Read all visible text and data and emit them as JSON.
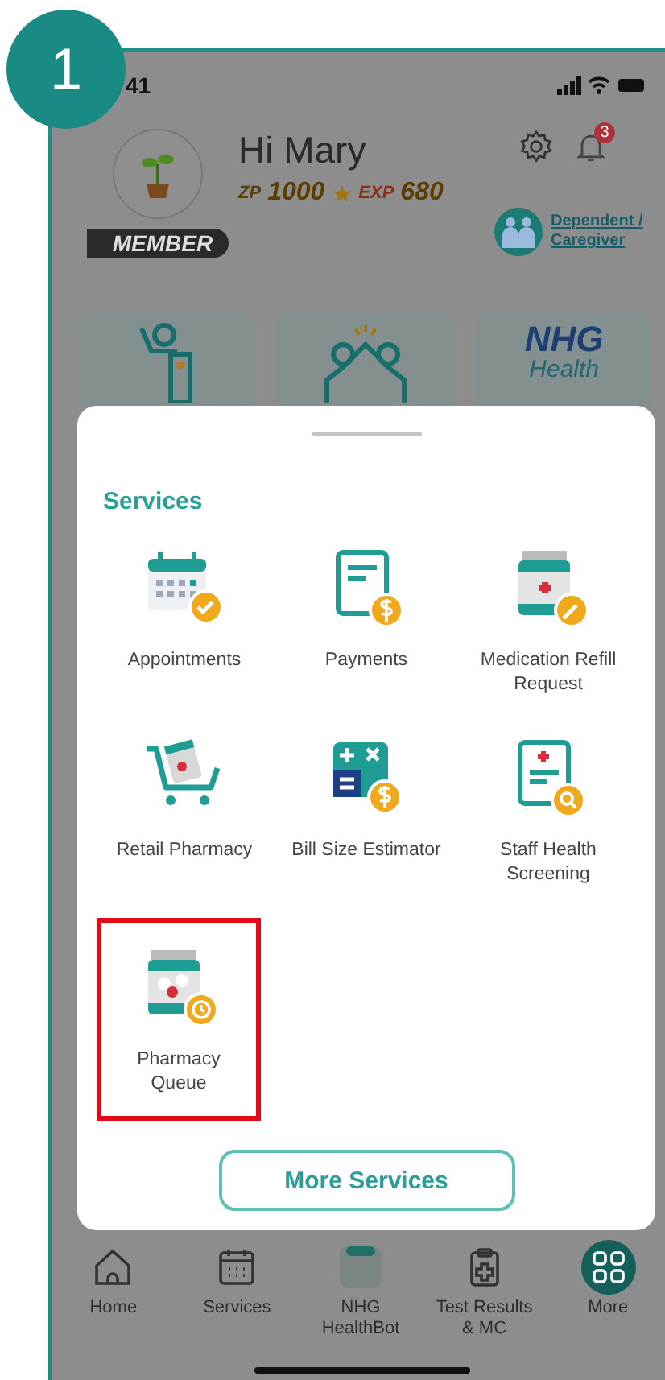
{
  "step_badge": "1",
  "status_bar": {
    "time": "41"
  },
  "profile": {
    "greeting": "Hi Mary",
    "zp_label": "ZP",
    "points": "1000",
    "exp_label": "EXP",
    "exp": "680",
    "membership": "MEMBER",
    "notification_count": "3",
    "dependent_link": "Dependent / Caregiver"
  },
  "shortcuts": [
    {
      "kind": "volunteer"
    },
    {
      "kind": "community"
    },
    {
      "kind": "logo",
      "title": "NHG",
      "subtitle": "Health"
    }
  ],
  "services_sheet": {
    "title": "Services",
    "items": [
      {
        "label": "Appointments",
        "kind": "calendar",
        "highlighted": false
      },
      {
        "label": "Payments",
        "kind": "bill",
        "highlighted": false
      },
      {
        "label": "Medication Refill Request",
        "kind": "refill",
        "highlighted": false
      },
      {
        "label": "Retail Pharmacy",
        "kind": "cart",
        "highlighted": false
      },
      {
        "label": "Bill Size Estimator",
        "kind": "calculator",
        "highlighted": false
      },
      {
        "label": "Staff Health Screening",
        "kind": "screening",
        "highlighted": false
      },
      {
        "label": "Pharmacy Queue",
        "kind": "queue",
        "highlighted": true
      }
    ],
    "button": "More Services"
  },
  "bottom_nav": [
    {
      "label": "Home",
      "kind": "home",
      "selected": false
    },
    {
      "label": "Services",
      "kind": "calendar",
      "selected": false
    },
    {
      "label": "NHG HealthBot",
      "kind": "bot",
      "selected": false
    },
    {
      "label": "Test Results & MC",
      "kind": "clipboard",
      "selected": false
    },
    {
      "label": "More",
      "kind": "grid",
      "selected": true
    }
  ]
}
